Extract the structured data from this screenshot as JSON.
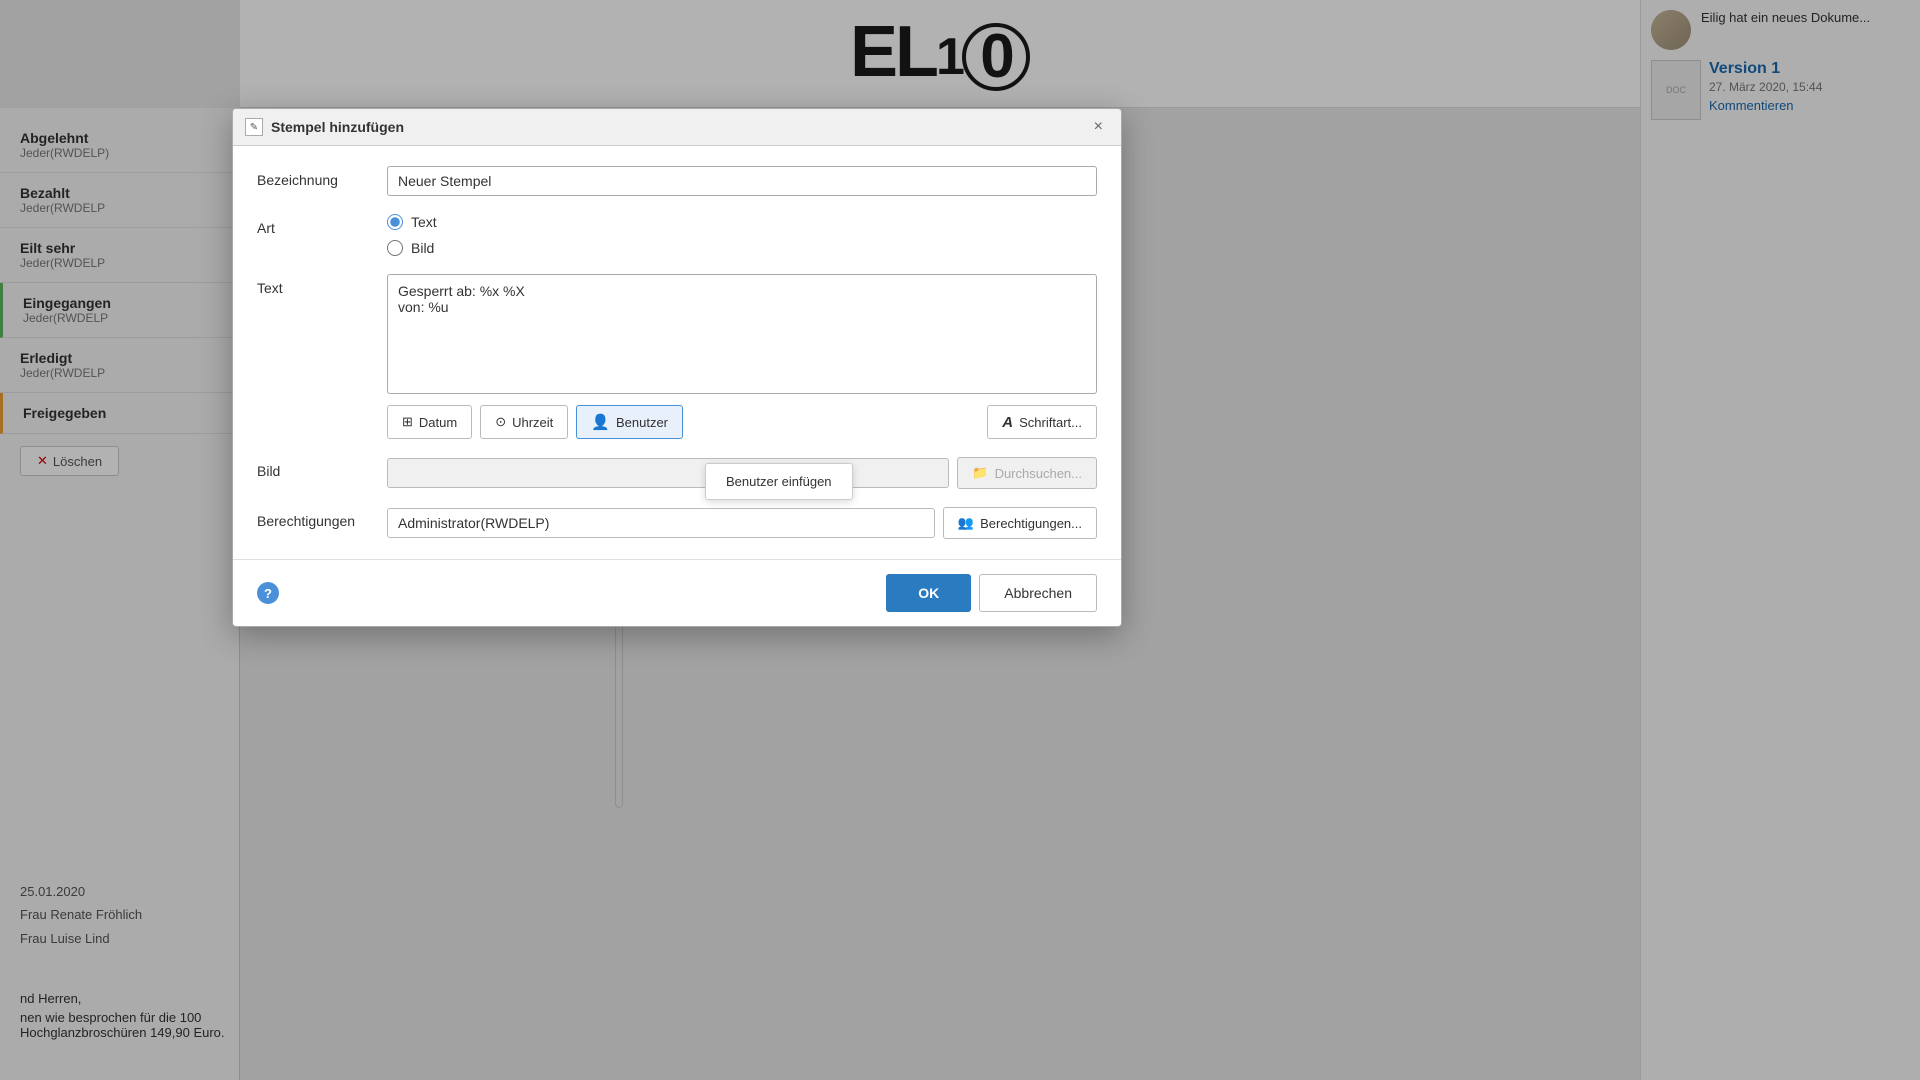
{
  "dialog": {
    "title": "Stempel hinzufügen",
    "close_label": "×",
    "fields": {
      "bezeichnung_label": "Bezeichnung",
      "bezeichnung_value": "Neuer Stempel",
      "art_label": "Art",
      "art_options": [
        {
          "id": "text",
          "label": "Text",
          "checked": true
        },
        {
          "id": "bild",
          "label": "Bild",
          "checked": false
        }
      ],
      "text_label": "Text",
      "text_value": "Gesperrt ab: %x %X\nvon: %u",
      "bild_label": "Bild",
      "bild_placeholder": "",
      "berechtigungen_label": "Berechtigungen",
      "berechtigungen_value": "Administrator(RWDELP)"
    },
    "insert_buttons": {
      "datum_label": "Datum",
      "uhrzeit_label": "Uhrzeit",
      "benutzer_label": "Benutzer",
      "schriftart_label": "Schriftart..."
    },
    "bild_browse_label": "Durchsuchen...",
    "perm_button_label": "Berechtigungen...",
    "ok_label": "OK",
    "cancel_label": "Abbrechen"
  },
  "tooltip": {
    "text": "Benutzer einfügen"
  },
  "sidebar": {
    "items": [
      {
        "title": "Abgelehnt",
        "sub": "Jeder(RWDELP)",
        "style": "normal"
      },
      {
        "title": "Bezahlt",
        "sub": "Jeder(RWDELP",
        "style": "normal"
      },
      {
        "title": "Eilt sehr",
        "sub": "Jeder(RWDELP",
        "style": "normal"
      },
      {
        "title": "Eingegangen",
        "sub": "Jeder(RWDELP",
        "style": "green"
      },
      {
        "title": "Erledigt",
        "sub": "Jeder(RWDELP",
        "style": "normal"
      },
      {
        "title": "Freigegeben",
        "sub": "",
        "style": "orange"
      }
    ],
    "delete_btn": "Löschen"
  },
  "bottom_info": {
    "date": "25.01.2020",
    "person1": "Frau Renate Fröhlich",
    "person2": "Frau Luise Lind"
  },
  "bottom_text": {
    "line1": "nd Herren,",
    "line2": "nen wie besprochen für die 100 Hochglanzbroschüren 149,90 Euro."
  },
  "right_panel": {
    "notification": "Eilig hat ein neues Dokume...",
    "version_label": "Version 1",
    "version_date": "27. März 2020, 15:44",
    "version_action": "Kommentieren"
  },
  "icons": {
    "stamp_icon": "✎",
    "datum_icon": "⊞",
    "uhrzeit_icon": "⊙",
    "benutzer_icon": "👤",
    "schriftart_icon": "A",
    "browse_icon": "📁",
    "perm_icon": "👥",
    "help_icon": "?"
  }
}
